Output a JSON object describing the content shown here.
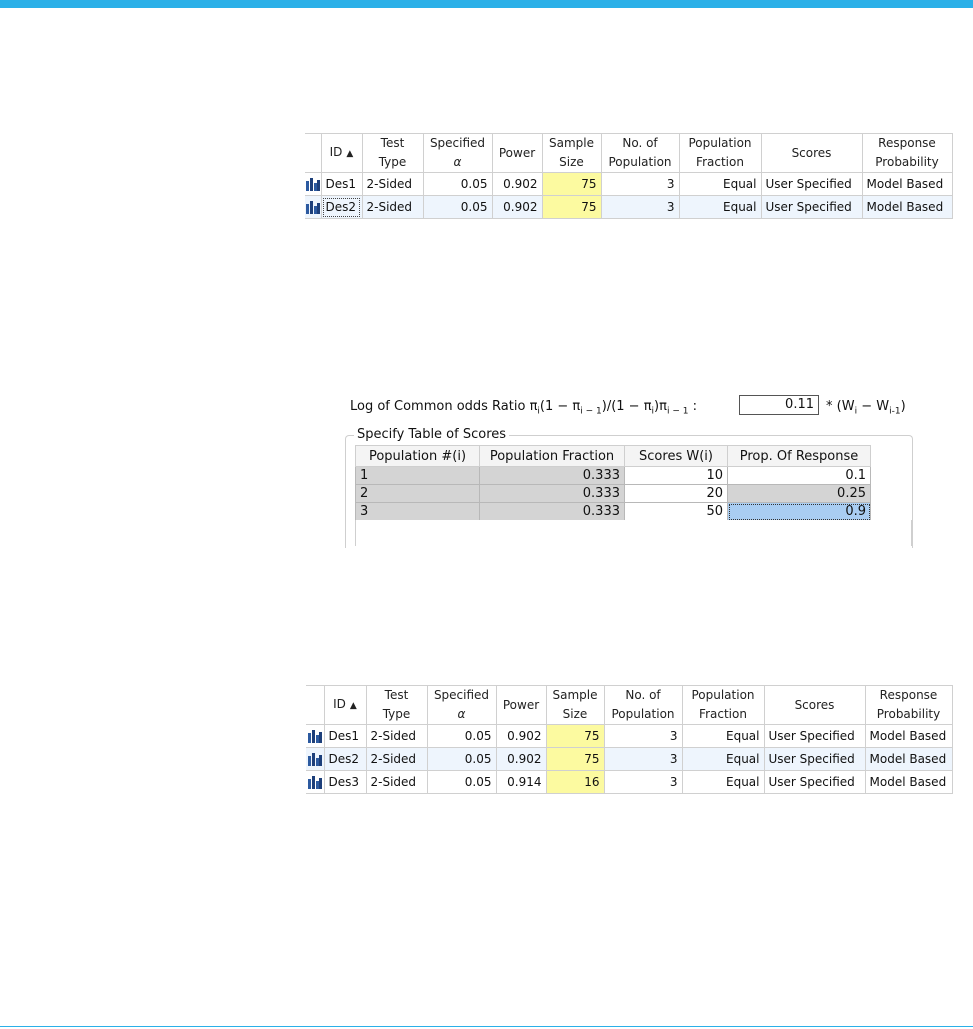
{
  "table_top": {
    "headers": [
      "",
      "ID",
      "Test Type",
      "Specified α",
      "Power",
      "Sample Size",
      "No. of Population",
      "Population Fraction",
      "Scores",
      "Response Probability"
    ],
    "headers_multiline": {
      "test_type": [
        "Test",
        "Type"
      ],
      "specified": [
        "Specified",
        "α"
      ],
      "sample_size": [
        "Sample",
        "Size"
      ],
      "no_of_population": [
        "No. of",
        "Population"
      ],
      "population_fraction": [
        "Population",
        "Fraction"
      ],
      "response_probability": [
        "Response",
        "Probability"
      ]
    },
    "header_id": "ID",
    "header_power": "Power",
    "header_scores": "Scores",
    "rows": [
      {
        "id": "Des1",
        "test_type": "2-Sided",
        "alpha": "0.05",
        "power": "0.902",
        "sample_size": "75",
        "n_pop": "3",
        "fraction": "Equal",
        "scores": "User Specified",
        "response": "Model Based"
      },
      {
        "id": "Des2",
        "test_type": "2-Sided",
        "alpha": "0.05",
        "power": "0.902",
        "sample_size": "75",
        "n_pop": "3",
        "fraction": "Equal",
        "scores": "User Specified",
        "response": "Model Based"
      }
    ]
  },
  "odds": {
    "label_prefix": "Log of Common odds Ratio π",
    "value": "0.11",
    "suffix": "* (W"
  },
  "scores_group": {
    "title": "Specify Table of Scores",
    "headers": [
      "Population #(i)",
      "Population Fraction",
      "Scores W(i)",
      "Prop. Of Response"
    ],
    "rows": [
      {
        "pop": "1",
        "fraction": "0.333",
        "score": "10",
        "prop": "0.1"
      },
      {
        "pop": "2",
        "fraction": "0.333",
        "score": "20",
        "prop": "0.25"
      },
      {
        "pop": "3",
        "fraction": "0.333",
        "score": "50",
        "prop": "0.9"
      }
    ]
  },
  "table_bottom": {
    "rows": [
      {
        "id": "Des1",
        "test_type": "2-Sided",
        "alpha": "0.05",
        "power": "0.902",
        "sample_size": "75",
        "n_pop": "3",
        "fraction": "Equal",
        "scores": "User Specified",
        "response": "Model Based"
      },
      {
        "id": "Des2",
        "test_type": "2-Sided",
        "alpha": "0.05",
        "power": "0.902",
        "sample_size": "75",
        "n_pop": "3",
        "fraction": "Equal",
        "scores": "User Specified",
        "response": "Model Based"
      },
      {
        "id": "Des3",
        "test_type": "2-Sided",
        "alpha": "0.05",
        "power": "0.914",
        "sample_size": "16",
        "n_pop": "3",
        "fraction": "Equal",
        "scores": "User Specified",
        "response": "Model Based"
      }
    ]
  },
  "icons": {
    "design_row": "chart-bar-icon",
    "sort": "sort-ascending-icon"
  },
  "colors": {
    "accent": "#2bb0e8",
    "sample_highlight": "#fcfaa0",
    "alt_row": "#eef5fd",
    "selected_cell": "#a9cdf2",
    "gray_cell": "#d4d4d4"
  }
}
